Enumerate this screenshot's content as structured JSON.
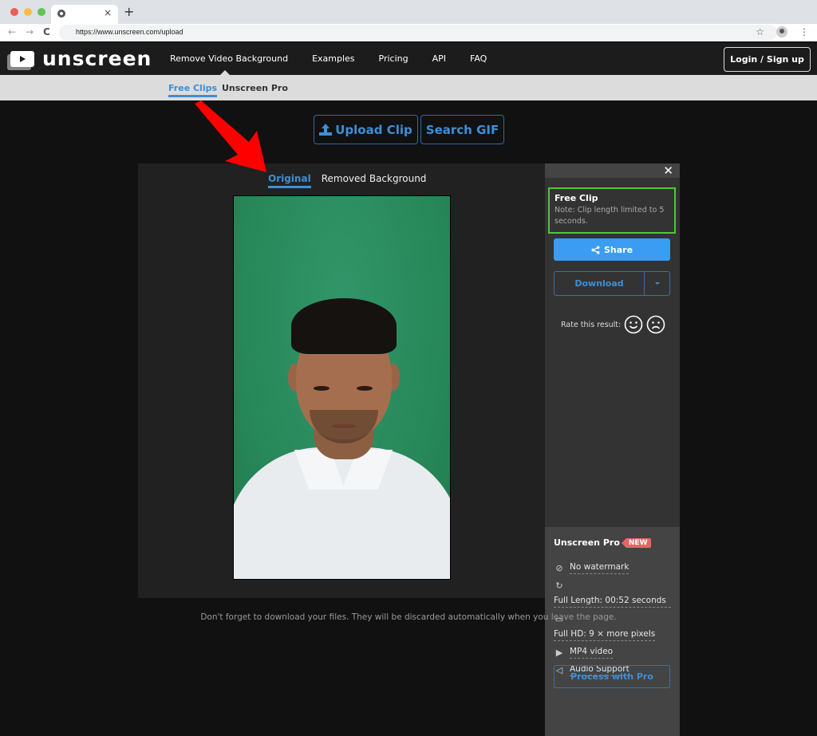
{
  "browser": {
    "tab_close": "×",
    "new_tab": "+",
    "url": "https://www.unscreen.com/upload",
    "nav": {
      "back": "←",
      "forward": "→",
      "reload": "C"
    },
    "bookmark_icon": "☆",
    "menu_icon": "⋮",
    "traffic_colors": [
      "#ee5c55",
      "#f6be4f",
      "#5fc454"
    ]
  },
  "header": {
    "logo_text": "unscreen",
    "nav": [
      "Remove Video Background",
      "Examples",
      "Pricing",
      "API",
      "FAQ"
    ],
    "login": "Login / Sign up"
  },
  "subnav": {
    "free": "Free Clips",
    "pro": "Unscreen Pro"
  },
  "actions": {
    "upload": "Upload Clip",
    "search_gif": "Search GIF"
  },
  "viewer": {
    "tabs": [
      "Original",
      "Removed Background"
    ],
    "active_tab": "Original"
  },
  "sidebar": {
    "close": "✕",
    "free_clip_title": "Free Clip",
    "free_clip_note": "Note: Clip length limited to 5 seconds.",
    "share": "Share",
    "download": "Download",
    "rate_label": "Rate this result:",
    "pro": {
      "title": "Unscreen Pro",
      "badge": "NEW",
      "features": [
        {
          "icon": "no-watermark-icon",
          "label": "No watermark"
        },
        {
          "icon": "clock-icon",
          "label": "Full Length: 00:52 seconds"
        },
        {
          "icon": "monitor-icon",
          "label": "Full HD: 9 × more pixels"
        },
        {
          "icon": "video-file-icon",
          "label": "MP4 video"
        },
        {
          "icon": "speaker-icon",
          "label": "Audio Support"
        }
      ],
      "button": "Process with Pro"
    }
  },
  "footer_note": "Don't forget to download your files. They will be discarded automatically when you leave the page.",
  "colors": {
    "accent": "#3d8fd6",
    "share": "#3a9cf2",
    "free_box_border": "#4cc938",
    "badge": "#e86464",
    "annotation": "#ff0000"
  }
}
